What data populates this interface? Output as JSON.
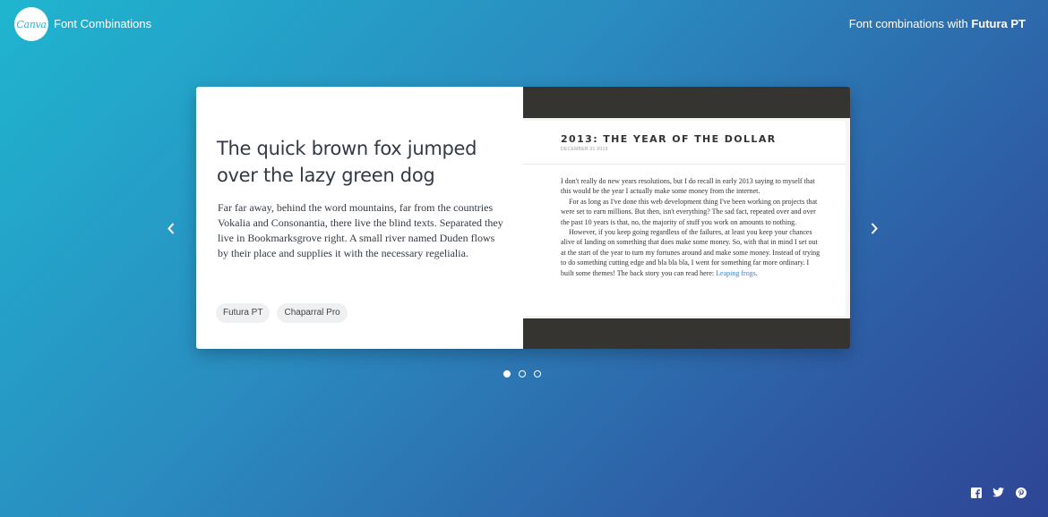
{
  "header": {
    "logo_text": "Canva",
    "app_title": "Font Combinations",
    "right_prefix": "Font combinations with ",
    "right_font": "Futura PT"
  },
  "card": {
    "heading": "The quick brown fox jumped over the lazy green dog",
    "body": "Far far away, behind the word mountains, far from the countries Vokalia and Consonantia, there live the blind texts. Separated they live in Bookmarksgrove right. A small river named Duden flows by their place and supplies it with the necessary regelialia.",
    "tags": [
      "Futura PT",
      "Chaparral Pro"
    ],
    "preview": {
      "title": "2013: THE YEAR OF THE DOLLAR",
      "date": "DECEMBER 31 2013",
      "paragraphs": [
        "I don't really do new years resolutions, but I do recall in early 2013 saying to myself that this would be the year I actually make some money from the internet.",
        "For as long as I've done this web development thing I've been working on projects that were set to earn millions. But then, isn't everything? The sad fact, repeated over and over the past 10 years is that, no, the majority of stuff you work on amounts to nothing.",
        "However, if you keep going regardless of the failures, at least you keep your chances alive of landing on something that does make some money. So, with that in mind I set out at the start of the year to turn my fortunes around and make some money. Instead of trying to do something cutting edge and bla bla bla, I went for something far more ordinary. I built some themes! The back story you can read here: "
      ],
      "link_text": "Leaping frogs",
      "link_suffix": "."
    }
  },
  "pager": {
    "count": 3,
    "active_index": 0
  },
  "social": [
    "facebook-icon",
    "twitter-icon",
    "pinterest-icon"
  ],
  "colors": {
    "gradient_start": "#1fb5cf",
    "gradient_end": "#2e4596",
    "preview_dark": "#353431",
    "link": "#3d7fc4"
  }
}
